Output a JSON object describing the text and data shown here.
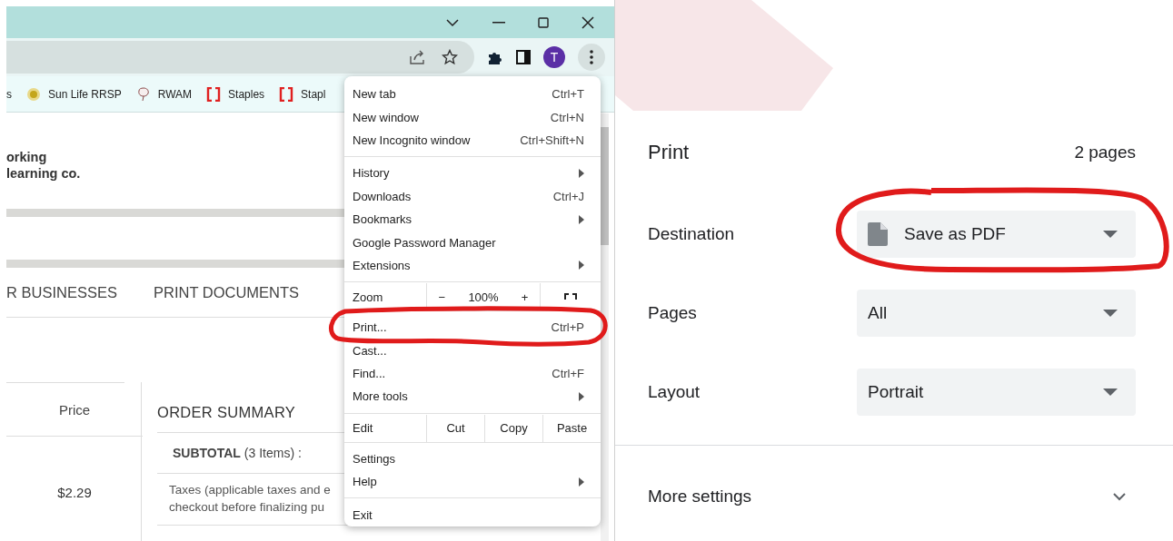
{
  "browser": {
    "bookmarks": [
      {
        "label": "s",
        "kind": "plain"
      },
      {
        "label": "Sun Life RRSP",
        "kind": "sun"
      },
      {
        "label": "RWAM",
        "kind": "balloon"
      },
      {
        "label": "Staples",
        "kind": "bracket"
      },
      {
        "label": "Stapl",
        "kind": "bracket"
      }
    ],
    "avatar_letter": "T"
  },
  "page": {
    "logo_lines": [
      "orking",
      "learning co."
    ],
    "nav": [
      "R BUSINESSES",
      "PRINT DOCUMENTS"
    ],
    "price_header": "Price",
    "price": "$2.29",
    "order_summary": {
      "title": "ORDER SUMMARY",
      "subtotal_label": "SUBTOTAL",
      "subtotal_count": "(3 Items) :",
      "taxes_lines": [
        "Taxes (applicable taxes and e",
        "checkout before finalizing pu"
      ]
    }
  },
  "menu": {
    "sections": [
      [
        {
          "kind": "item",
          "label": "New tab",
          "shortcut": "Ctrl+T",
          "submenu": false
        },
        {
          "kind": "item",
          "label": "New window",
          "shortcut": "Ctrl+N",
          "submenu": false
        },
        {
          "kind": "item",
          "label": "New Incognito window",
          "shortcut": "Ctrl+Shift+N",
          "submenu": false
        }
      ],
      [
        {
          "kind": "item",
          "label": "History",
          "submenu": true
        },
        {
          "kind": "item",
          "label": "Downloads",
          "shortcut": "Ctrl+J",
          "submenu": false
        },
        {
          "kind": "item",
          "label": "Bookmarks",
          "submenu": true
        },
        {
          "kind": "item",
          "label": "Google Password Manager",
          "submenu": false
        },
        {
          "kind": "item",
          "label": "Extensions",
          "submenu": true
        }
      ],
      [
        {
          "kind": "zoom",
          "label": "Zoom",
          "minus": "−",
          "value": "100%",
          "plus": "+"
        }
      ],
      [
        {
          "kind": "item",
          "label": "Print...",
          "shortcut": "Ctrl+P",
          "submenu": false
        },
        {
          "kind": "item",
          "label": "Cast...",
          "submenu": false
        },
        {
          "kind": "item",
          "label": "Find...",
          "shortcut": "Ctrl+F",
          "submenu": false
        },
        {
          "kind": "item",
          "label": "More tools",
          "submenu": true
        }
      ],
      [
        {
          "kind": "edit",
          "label": "Edit",
          "actions": [
            "Cut",
            "Copy",
            "Paste"
          ]
        }
      ],
      [
        {
          "kind": "item",
          "label": "Settings",
          "submenu": false
        },
        {
          "kind": "item",
          "label": "Help",
          "submenu": true
        }
      ],
      [
        {
          "kind": "item",
          "label": "Exit",
          "submenu": false
        }
      ]
    ]
  },
  "print_dialog": {
    "title": "Print",
    "page_count": "2 pages",
    "settings": [
      {
        "label": "Destination",
        "value": "Save as PDF",
        "kind": "destination"
      },
      {
        "label": "Pages",
        "value": "All",
        "kind": "plain"
      },
      {
        "label": "Layout",
        "value": "Portrait",
        "kind": "plain"
      }
    ],
    "more_settings": {
      "label": "More settings",
      "expanded": false
    }
  }
}
